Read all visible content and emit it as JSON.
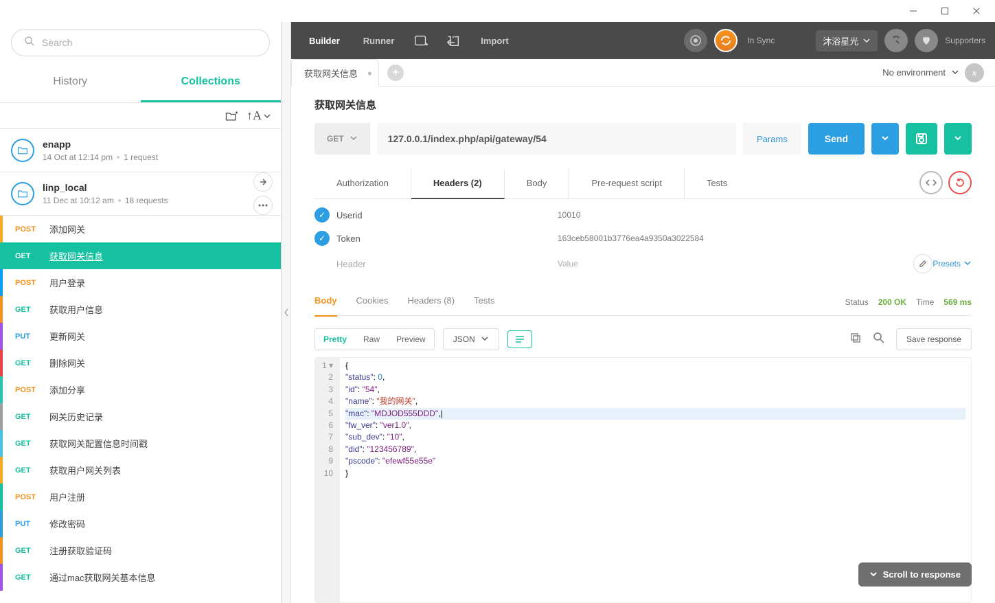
{
  "window": {
    "title": ""
  },
  "search": {
    "placeholder": "Search"
  },
  "sidebarTabs": {
    "history": "History",
    "collections": "Collections"
  },
  "collections": [
    {
      "name": "enapp",
      "date": "14 Oct at 12:14 pm",
      "count": "1 request"
    },
    {
      "name": "linp_local",
      "date": "11 Dec at 10:12 am",
      "count": "18 requests"
    }
  ],
  "requests": [
    {
      "method": "POST",
      "label": "添加网关",
      "rail": "#f7aa28"
    },
    {
      "method": "GET",
      "label": "获取网关信息",
      "active": true,
      "rail": "#15c1a0"
    },
    {
      "method": "POST",
      "label": "用户登录",
      "rail": "#0f9df2"
    },
    {
      "method": "GET",
      "label": "获取用户信息",
      "rail": "#f29221"
    },
    {
      "method": "PUT",
      "label": "更新网关",
      "rail": "#a052e6"
    },
    {
      "method": "GET",
      "label": "删除网关",
      "rail": "#e64545"
    },
    {
      "method": "POST",
      "label": "添加分享",
      "rail": "#2bc3b1"
    },
    {
      "method": "GET",
      "label": "网关历史记录",
      "rail": "#9e9e9e"
    },
    {
      "method": "GET",
      "label": "获取网关配置信息时间戳",
      "rail": "#46c2e3"
    },
    {
      "method": "GET",
      "label": "获取用户网关列表",
      "rail": "#f7aa28"
    },
    {
      "method": "POST",
      "label": "用户注册",
      "rail": "#15c1a0"
    },
    {
      "method": "PUT",
      "label": "修改密码",
      "rail": "#2c9ee2"
    },
    {
      "method": "GET",
      "label": "注册获取验证码",
      "rail": "#f29221"
    },
    {
      "method": "GET",
      "label": "通过mac获取网关基本信息",
      "rail": "#a052e6"
    }
  ],
  "topbar": {
    "builder": "Builder",
    "runner": "Runner",
    "import": "Import",
    "sync": "In Sync",
    "username": "沐浴星光",
    "supporters": "Supporters"
  },
  "activeTab": {
    "name": "获取网关信息"
  },
  "env": {
    "label": "No environment"
  },
  "request": {
    "title": "获取网关信息",
    "method": "GET",
    "url": "127.0.0.1/index.php/api/gateway/54",
    "params": "Params",
    "send": "Send"
  },
  "reqSections": {
    "authorization": "Authorization",
    "headers": "Headers (2)",
    "body": "Body",
    "prerequest": "Pre-request script",
    "tests": "Tests"
  },
  "headers": [
    {
      "key": "Userid",
      "value": "10010"
    },
    {
      "key": "Token",
      "value": "163ceb58001b3776ea4a9350a3022584"
    }
  ],
  "headers_placeholder": {
    "key": "Header",
    "value": "Value",
    "presets": "Presets"
  },
  "respTabs": {
    "body": "Body",
    "cookies": "Cookies",
    "headers": "Headers (8)",
    "tests": "Tests"
  },
  "respMeta": {
    "statusLabel": "Status",
    "status": "200 OK",
    "timeLabel": "Time",
    "time": "569 ms"
  },
  "viewModes": {
    "pretty": "Pretty",
    "raw": "Raw",
    "preview": "Preview",
    "json": "JSON",
    "saveResponse": "Save response"
  },
  "scrollBtn": "Scroll to response",
  "responseBody": {
    "lines": [
      {
        "n": "1",
        "tokens": [
          {
            "t": "{",
            "c": ""
          }
        ]
      },
      {
        "n": "2",
        "tokens": [
          {
            "t": "    ",
            "c": ""
          },
          {
            "t": "\"status\"",
            "c": "k"
          },
          {
            "t": ": ",
            "c": ""
          },
          {
            "t": "0",
            "c": "lit"
          },
          {
            "t": ",",
            "c": ""
          }
        ]
      },
      {
        "n": "3",
        "tokens": [
          {
            "t": "    ",
            "c": ""
          },
          {
            "t": "\"id\"",
            "c": "k"
          },
          {
            "t": ": ",
            "c": ""
          },
          {
            "t": "\"54\"",
            "c": "s"
          },
          {
            "t": ",",
            "c": ""
          }
        ]
      },
      {
        "n": "4",
        "tokens": [
          {
            "t": "    ",
            "c": ""
          },
          {
            "t": "\"name\"",
            "c": "k"
          },
          {
            "t": ": ",
            "c": ""
          },
          {
            "t": "\"我的网关\"",
            "c": "n"
          },
          {
            "t": ",",
            "c": ""
          }
        ]
      },
      {
        "n": "5",
        "hl": true,
        "tokens": [
          {
            "t": "    ",
            "c": ""
          },
          {
            "t": "\"mac\"",
            "c": "k"
          },
          {
            "t": ": ",
            "c": ""
          },
          {
            "t": "\"MDJOD555DDD\"",
            "c": "s"
          },
          {
            "t": ",|",
            "c": ""
          }
        ]
      },
      {
        "n": "6",
        "tokens": [
          {
            "t": "    ",
            "c": ""
          },
          {
            "t": "\"fw_ver\"",
            "c": "k"
          },
          {
            "t": ": ",
            "c": ""
          },
          {
            "t": "\"ver1.0\"",
            "c": "s"
          },
          {
            "t": ",",
            "c": ""
          }
        ]
      },
      {
        "n": "7",
        "tokens": [
          {
            "t": "    ",
            "c": ""
          },
          {
            "t": "\"sub_dev\"",
            "c": "k"
          },
          {
            "t": ": ",
            "c": ""
          },
          {
            "t": "\"10\"",
            "c": "s"
          },
          {
            "t": ",",
            "c": ""
          }
        ]
      },
      {
        "n": "8",
        "tokens": [
          {
            "t": "    ",
            "c": ""
          },
          {
            "t": "\"did\"",
            "c": "k"
          },
          {
            "t": ": ",
            "c": ""
          },
          {
            "t": "\"123456789\"",
            "c": "s"
          },
          {
            "t": ",",
            "c": ""
          }
        ]
      },
      {
        "n": "9",
        "tokens": [
          {
            "t": "    ",
            "c": ""
          },
          {
            "t": "\"pscode\"",
            "c": "k"
          },
          {
            "t": ": ",
            "c": ""
          },
          {
            "t": "\"efewf55e55e\"",
            "c": "s"
          }
        ]
      },
      {
        "n": "10",
        "tokens": [
          {
            "t": "}",
            "c": ""
          }
        ]
      }
    ]
  }
}
